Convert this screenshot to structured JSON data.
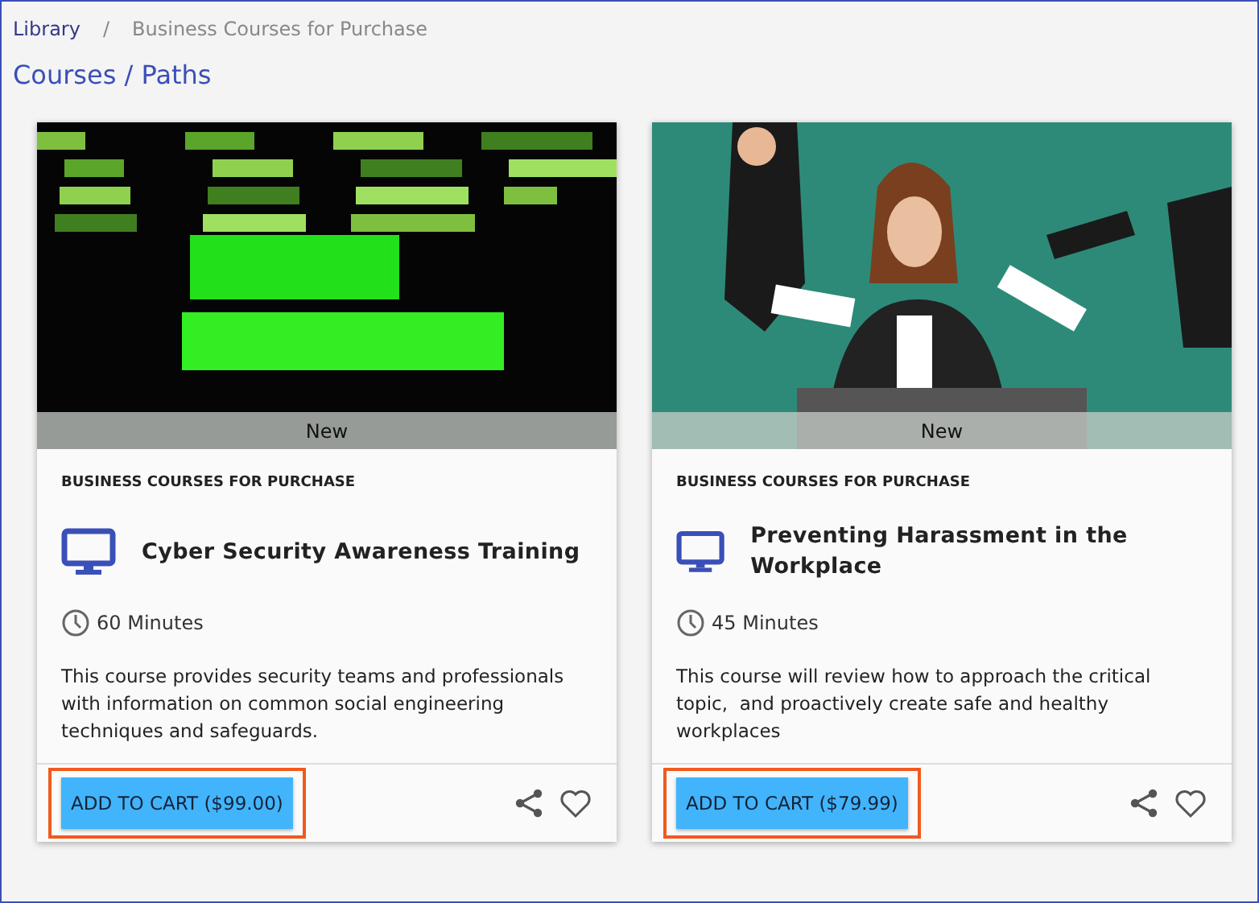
{
  "breadcrumb": [
    {
      "label": "Library",
      "kind": "link"
    },
    {
      "label": "/",
      "kind": "separator"
    },
    {
      "label": "Business Courses for Purchase",
      "kind": "current"
    }
  ],
  "page_title": "Courses / Paths",
  "cards": [
    {
      "badge": "New",
      "category": "BUSINESS COURSES FOR PURCHASE",
      "title": "Cyber Security Awareness Training",
      "duration": "60 Minutes",
      "description": "This course provides security teams and professionals with information on common social engineering techniques and safeguards.",
      "button": "ADD TO CART ($99.00)",
      "highlighted": true,
      "favorite": false
    },
    {
      "badge": "New",
      "category": "BUSINESS COURSES FOR PURCHASE",
      "title": "Preventing Harassment in the Workplace",
      "duration": "45 Minutes",
      "description": "This course will review how to approach the critical topic,  and proactively create safe and healthy workplaces",
      "button": "ADD TO CART ($79.99)",
      "highlighted": true,
      "favorite": false
    }
  ]
}
